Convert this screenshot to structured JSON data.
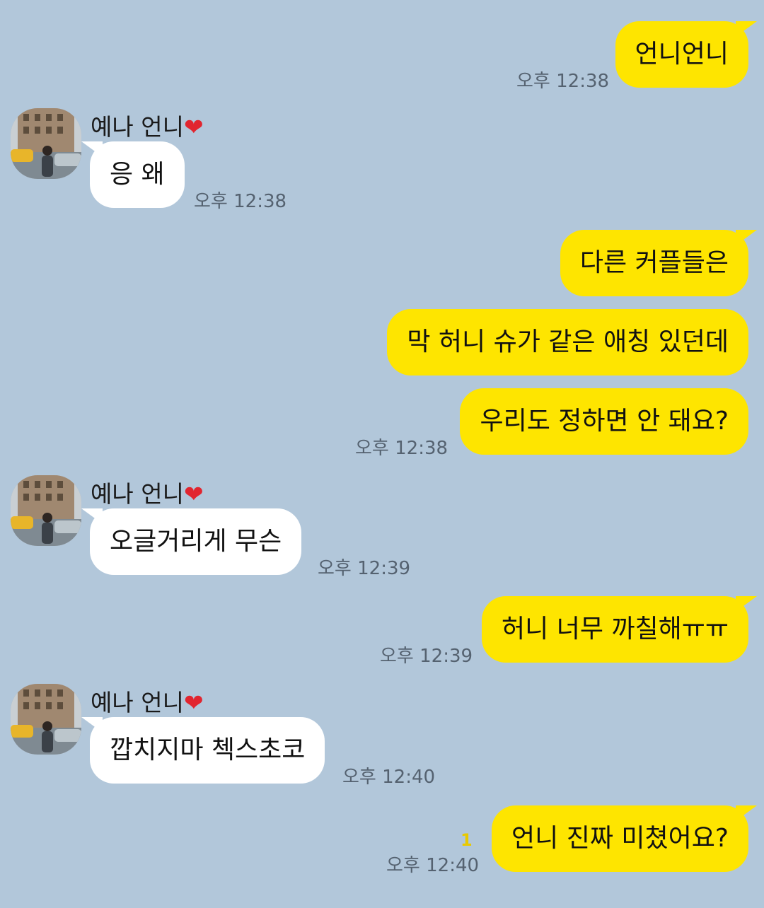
{
  "contact": {
    "name": "예나 언니",
    "heart": "❤"
  },
  "messages": [
    {
      "from": "me",
      "text": "언니언니",
      "time": "오후 12:38"
    },
    {
      "from": "them",
      "text": "응 왜",
      "time": "오후 12:38"
    },
    {
      "from": "me",
      "text": "다른 커플들은"
    },
    {
      "from": "me",
      "text": "막 허니 슈가 같은 애칭 있던데"
    },
    {
      "from": "me",
      "text": "우리도 정하면 안 돼요?",
      "time": "오후 12:38"
    },
    {
      "from": "them",
      "text": "오글거리게 무슨",
      "time": "오후 12:39"
    },
    {
      "from": "me",
      "text": "허니 너무 까칠해ㅠㅠ",
      "time": "오후 12:39"
    },
    {
      "from": "them",
      "text": "깝치지마 첵스초코",
      "time": "오후 12:40"
    },
    {
      "from": "me",
      "text": "언니 진짜 미쳤어요?",
      "time": "오후 12:40",
      "unread": "1"
    }
  ],
  "colors": {
    "background": "#b2c7da",
    "my_bubble": "#fee500",
    "their_bubble": "#ffffff",
    "heart": "#e1252f"
  }
}
